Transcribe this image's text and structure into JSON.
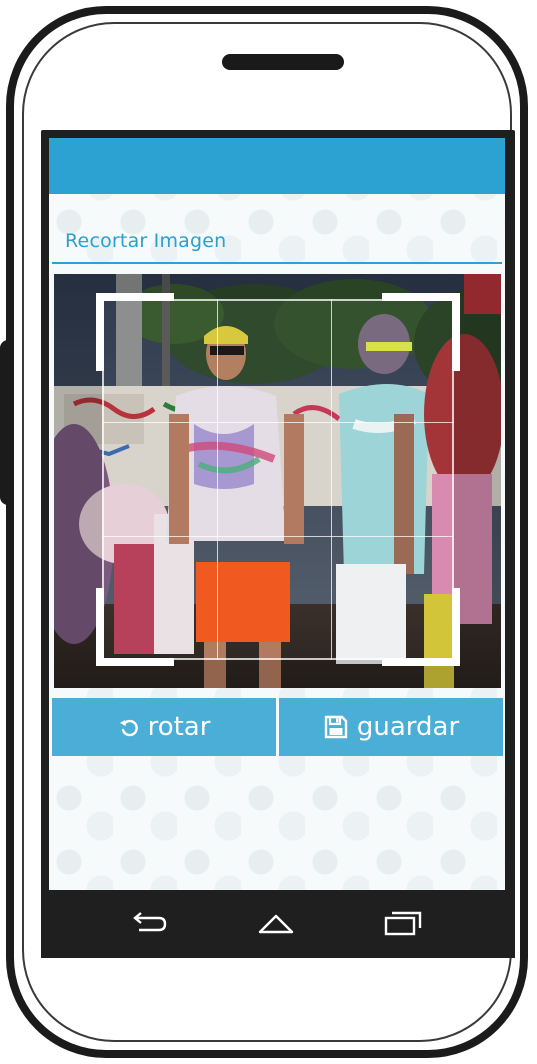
{
  "screen": {
    "section_title": "Recortar Imagen"
  },
  "buttons": {
    "rotate_label": "rotar",
    "rotate_icon": "rotate-icon",
    "save_label": "guardar",
    "save_icon": "floppy-disk-icon"
  },
  "navigation": {
    "back_icon": "back-arrow-icon",
    "home_icon": "home-icon",
    "recents_icon": "recent-apps-icon"
  },
  "colors": {
    "accent": "#2ba2d2",
    "button": "#4aaed6",
    "nav_bar": "#1f1f1f",
    "frame": "#1b1b1b"
  }
}
